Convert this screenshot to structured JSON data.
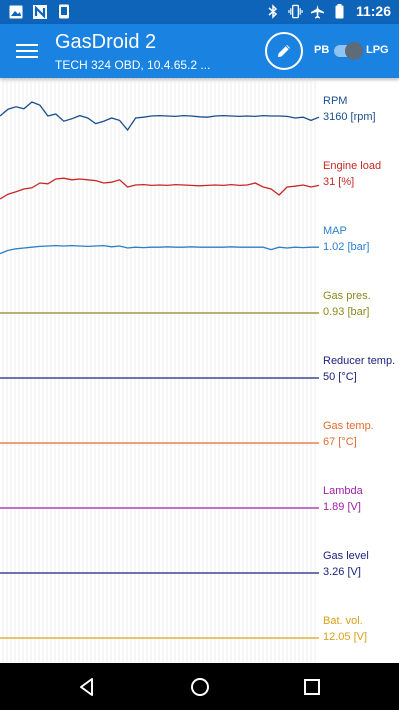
{
  "status_bar": {
    "icons_left": [
      "image-icon",
      "n-icon",
      "device-icon"
    ],
    "icons_right": [
      "bluetooth-icon",
      "vibrate-icon",
      "airplane-icon",
      "battery-icon"
    ],
    "time": "11:26"
  },
  "app_bar": {
    "title": "GasDroid 2",
    "subtitle": "TECH 324 OBD, 10.4.65.2 ...",
    "fuel_left": "PB",
    "fuel_right": "LPG",
    "toggle_on": true
  },
  "chart_data": {
    "type": "line",
    "series": [
      {
        "name": "RPM",
        "value": "3160 [rpm]",
        "color": "#1b4f8a",
        "values": [
          0.55,
          0.72,
          0.78,
          0.73,
          0.9,
          0.82,
          0.55,
          0.6,
          0.42,
          0.48,
          0.56,
          0.5,
          0.36,
          0.42,
          0.5,
          0.44,
          0.2,
          0.5,
          0.52,
          0.55,
          0.56,
          0.55,
          0.54,
          0.56,
          0.55,
          0.53,
          0.52,
          0.55,
          0.56,
          0.55,
          0.54,
          0.55,
          0.54,
          0.56,
          0.55,
          0.55,
          0.54,
          0.5,
          0.52,
          0.44,
          0.52
        ]
      },
      {
        "name": "Engine load",
        "value": "31 [%]",
        "color": "#c62828",
        "values": [
          0.1,
          0.22,
          0.28,
          0.35,
          0.38,
          0.5,
          0.48,
          0.6,
          0.62,
          0.58,
          0.6,
          0.58,
          0.56,
          0.5,
          0.52,
          0.58,
          0.4,
          0.45,
          0.46,
          0.44,
          0.45,
          0.44,
          0.46,
          0.45,
          0.44,
          0.43,
          0.44,
          0.45,
          0.44,
          0.46,
          0.44,
          0.45,
          0.5,
          0.4,
          0.35,
          0.2,
          0.4,
          0.42,
          0.45,
          0.4,
          0.44
        ]
      },
      {
        "name": "MAP",
        "value": "1.02 [bar]",
        "color": "#2a7fc9",
        "values": [
          0.36,
          0.44,
          0.48,
          0.5,
          0.52,
          0.54,
          0.55,
          0.56,
          0.55,
          0.56,
          0.55,
          0.54,
          0.55,
          0.56,
          0.53,
          0.55,
          0.5,
          0.52,
          0.51,
          0.52,
          0.52,
          0.53,
          0.52,
          0.52,
          0.53,
          0.52,
          0.52,
          0.52,
          0.52,
          0.53,
          0.52,
          0.52,
          0.52,
          0.52,
          0.46,
          0.52,
          0.5,
          0.52,
          0.51,
          0.52,
          0.52
        ]
      },
      {
        "name": "Gas pres.",
        "value": "0.93 [bar]",
        "color": "#8a8a1a",
        "values": [
          0.5,
          0.5
        ]
      },
      {
        "name": "Reducer temp.",
        "value": "50 [°C]",
        "color": "#1a237e",
        "values": [
          0.5,
          0.5
        ]
      },
      {
        "name": "Gas temp.",
        "value": "67 [°C]",
        "color": "#e06c2e",
        "values": [
          0.5,
          0.5
        ]
      },
      {
        "name": "Lambda",
        "value": "1.89 [V]",
        "color": "#a020a8",
        "values": [
          0.5,
          0.5
        ]
      },
      {
        "name": "Gas level",
        "value": "3.26 [V]",
        "color": "#1a237e",
        "values": [
          0.5,
          0.5
        ]
      },
      {
        "name": "Bat. vol.",
        "value": "12.05 [V]",
        "color": "#d9a21b",
        "values": [
          0.5,
          0.5
        ]
      }
    ]
  },
  "nav_bar": {
    "back": "back-icon",
    "home": "home-icon",
    "recents": "recents-icon"
  }
}
